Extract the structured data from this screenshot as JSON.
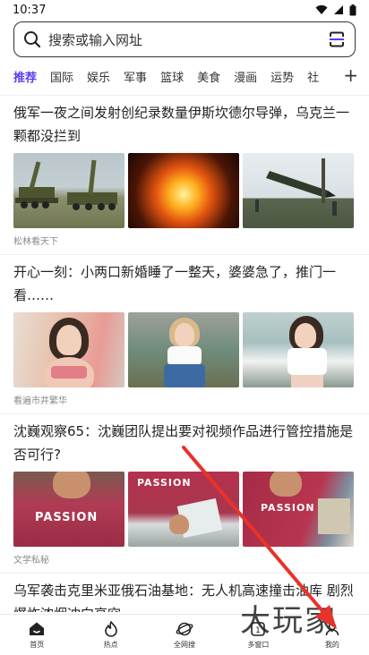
{
  "status": {
    "time": "10:37"
  },
  "search": {
    "placeholder": "搜索或输入网址"
  },
  "tabs": [
    {
      "label": "推荐",
      "active": true
    },
    {
      "label": "国际"
    },
    {
      "label": "娱乐"
    },
    {
      "label": "军事"
    },
    {
      "label": "篮球"
    },
    {
      "label": "美食"
    },
    {
      "label": "漫画"
    },
    {
      "label": "运势"
    },
    {
      "label": "社"
    }
  ],
  "articles": [
    {
      "title": "俄军一夜之间发射创纪录数量伊斯坎德尔导弹，乌克兰一颗都没拦到",
      "source": "松林看天下"
    },
    {
      "title": "开心一刻：小两口新婚睡了一整天，婆婆急了，推门一看……",
      "source": "看遍市井繁华"
    },
    {
      "title": "沈巍观察65：沈巍团队提出要对视频作品进行管控措施是否可行?",
      "source": "文学私秘",
      "shirt_text": "PASSION"
    },
    {
      "title": "乌军袭击克里米亚俄石油基地：无人机高速撞击油库 剧烈爆炸浓烟冲向高空"
    }
  ],
  "bottom_nav": [
    {
      "label": "首页",
      "icon": "home-icon"
    },
    {
      "label": "热点",
      "icon": "flame-icon"
    },
    {
      "label": "全网搜",
      "icon": "planet-icon"
    },
    {
      "label": "多窗口",
      "icon": "windows-icon",
      "count": "1"
    },
    {
      "label": "我的",
      "icon": "user-icon"
    }
  ],
  "watermark": "大玩家",
  "colors": {
    "accent": "#5b3cf0",
    "annotation_arrow": "#e8332a"
  }
}
